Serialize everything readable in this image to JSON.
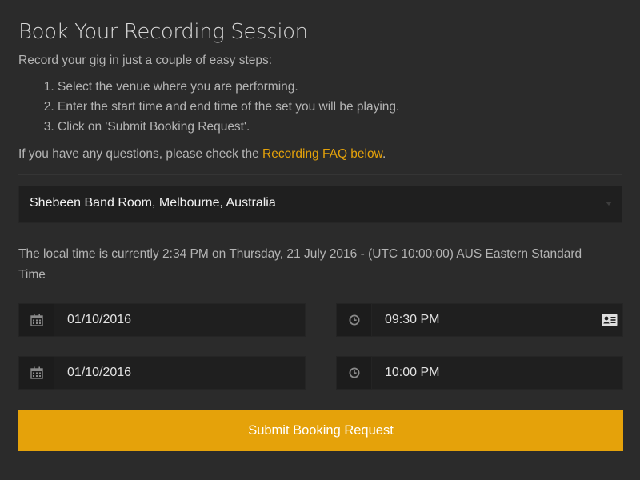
{
  "page": {
    "title": "Book Your Recording Session",
    "intro": "Record your gig in just a couple of easy steps:",
    "steps": [
      "Select the venue where you are performing.",
      "Enter the start time and end time of the set you will be playing.",
      "Click on 'Submit Booking Request'."
    ],
    "questions_prefix": "If you have any questions, please check the ",
    "faq_link": "Recording FAQ below",
    "questions_suffix": "."
  },
  "venue": {
    "selected": "Shebeen Band Room, Melbourne, Australia"
  },
  "local_time_text": "The local time is currently 2:34 PM on Thursday, 21 July 2016 - (UTC 10:00:00) AUS Eastern Standard Time",
  "booking": {
    "start_date": "01/10/2016",
    "start_time": "09:30 PM",
    "end_date": "01/10/2016",
    "end_time": "10:00 PM"
  },
  "submit_label": "Submit Booking Request",
  "icons": {
    "date": "calendar-icon",
    "time": "clock-icon",
    "autofill": "contact-card-icon",
    "select": "chevron-down-icon"
  },
  "colors": {
    "background": "#2b2b2b",
    "accent": "#e5a20a",
    "input_bg": "#1f1f1f"
  }
}
